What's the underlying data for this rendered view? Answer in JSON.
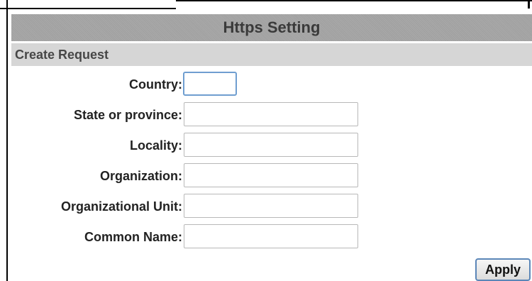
{
  "title": "Https Setting",
  "section": "Create Request",
  "fields": [
    {
      "label": "Country:",
      "value": ""
    },
    {
      "label": "State or province:",
      "value": ""
    },
    {
      "label": "Locality:",
      "value": ""
    },
    {
      "label": "Organization:",
      "value": ""
    },
    {
      "label": "Organizational Unit:",
      "value": ""
    },
    {
      "label": "Common Name:",
      "value": ""
    }
  ],
  "apply_label": "Apply",
  "colors": {
    "title_bar": "#a5a5a5",
    "section_bar": "#d6d6d6",
    "focus_border": "#6f9ed0",
    "button_border": "#5b86b8"
  }
}
